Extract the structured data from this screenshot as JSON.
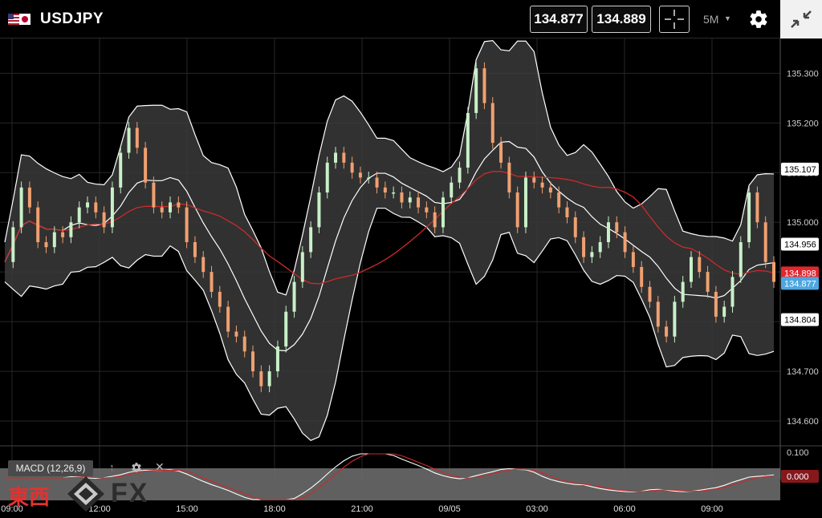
{
  "header": {
    "flag_icon": "us-jp-flag-icon",
    "symbol": "USDJPY",
    "bid": "134.877",
    "ask": "134.889",
    "crosshair_icon": "crosshair-icon",
    "timeframe": "5M",
    "settings_icon": "gear-icon",
    "collapse_icon": "collapse-arrows-icon"
  },
  "price_axis": {
    "ticks": [
      "135.300",
      "135.200",
      "135.100",
      "135.000",
      "134.900",
      "134.800",
      "134.700",
      "134.600"
    ],
    "tags": [
      {
        "label": "135.107",
        "value": 135.107,
        "color": "#ffffff"
      },
      {
        "label": "134.956",
        "value": 134.956,
        "color": "#ffffff"
      },
      {
        "label": "134.898",
        "value": 134.898,
        "color": "#e0282f"
      },
      {
        "label": "134.877",
        "value": 134.877,
        "color": "#4da6e0"
      },
      {
        "label": "134.804",
        "value": 134.804,
        "color": "#ffffff"
      }
    ]
  },
  "time_axis": {
    "labels": [
      "09:00",
      "12:00",
      "15:00",
      "18:00",
      "21:00",
      "09/05",
      "03:00",
      "06:00",
      "09:00"
    ]
  },
  "indicator": {
    "label": "MACD (12,26,9)",
    "axis_tick": "0.100",
    "value_tag": "0.000",
    "up_icon": "arrow-up-icon",
    "settings_icon": "gear-icon",
    "close_icon": "close-icon"
  },
  "watermark": {
    "cjk": "東西",
    "fx": "FX",
    "mark_icon": "diamond-logo-icon"
  },
  "colors": {
    "up": "#c8f0c8",
    "down": "#f0a070",
    "bands": "#ffffff",
    "ma": "#cc2a2a",
    "bid_tag": "#4da6e0",
    "ask_tag": "#e0282f"
  },
  "chart_data": {
    "type": "line",
    "series": [
      {
        "name": "",
        "values": [
          134.92,
          134.99,
          135.07,
          135.03,
          134.96,
          134.95,
          134.98,
          134.97,
          135.0,
          135.03,
          135.04,
          135.02,
          134.99,
          135.07,
          135.14,
          135.19,
          135.15,
          135.08,
          135.03,
          135.02,
          135.04,
          135.03,
          134.96,
          134.93,
          134.9,
          134.86,
          134.83,
          134.78,
          134.77,
          134.74,
          134.7,
          134.67,
          134.7,
          134.75,
          134.82,
          134.88,
          134.94,
          134.99,
          135.06,
          135.12,
          135.14,
          135.12,
          135.1,
          135.09,
          135.09,
          135.07,
          135.06,
          135.06,
          135.04,
          135.05,
          135.03,
          135.02,
          134.99,
          135.05,
          135.08,
          135.11,
          135.22,
          135.31,
          135.24,
          135.16,
          135.12,
          135.06,
          134.99,
          135.09,
          135.08,
          135.07,
          135.06,
          135.03,
          135.01,
          134.97,
          134.93,
          134.94,
          134.96,
          135.0,
          134.98,
          134.94,
          134.91,
          134.87,
          134.84,
          134.79,
          134.77,
          134.84,
          134.88,
          134.93,
          134.9,
          134.86,
          134.81,
          134.83,
          134.89,
          134.96,
          135.06,
          135.0,
          134.92,
          134.88
        ]
      }
    ],
    "ylim": [
      134.55,
      135.37
    ],
    "grid": true
  }
}
